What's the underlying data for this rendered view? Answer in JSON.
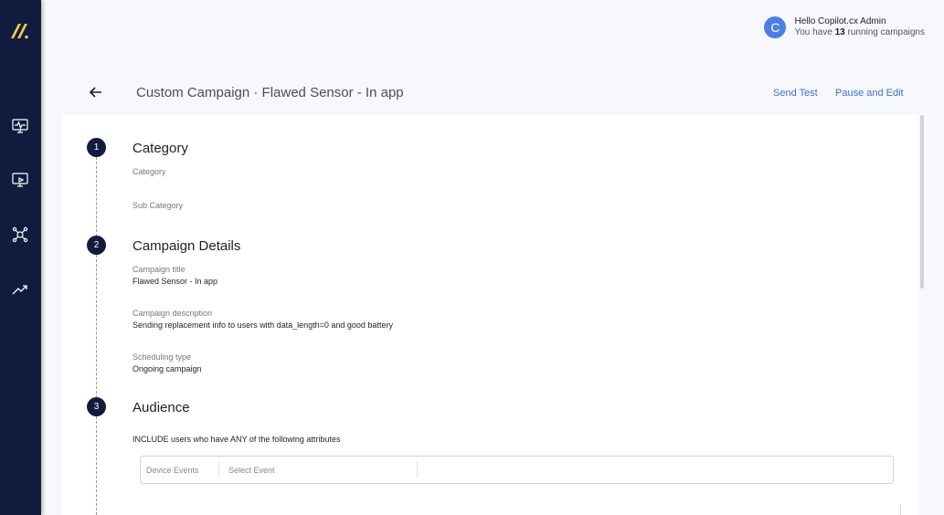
{
  "header": {
    "avatar_letter": "C",
    "greeting": "Hello Copilot.cx Admin",
    "running_prefix": "You have ",
    "running_count": "13",
    "running_suffix": " running campaigns"
  },
  "page": {
    "title": "Custom Campaign · Flawed Sensor - In app",
    "send_test": "Send Test",
    "pause_edit": "Pause and Edit"
  },
  "sidebar": {
    "items": [
      {
        "icon": "monitor-pulse-icon"
      },
      {
        "icon": "presentation-icon"
      },
      {
        "icon": "network-user-icon"
      },
      {
        "icon": "trending-up-icon"
      }
    ]
  },
  "steps": {
    "category": {
      "number": "1",
      "title": "Category",
      "category_label": "Category",
      "subcategory_label": "Sub Category"
    },
    "details": {
      "number": "2",
      "title": "Campaign Details",
      "title_label": "Campaign title",
      "title_value": "Flawed Sensor - In app",
      "description_label": "Campaign description",
      "description_value": "Sending replacement info to users with data_length=0 and good battery",
      "scheduling_label": "Scheduling type",
      "scheduling_value": "Ongoing campaign"
    },
    "audience": {
      "number": "3",
      "title": "Audience",
      "include_text": "INCLUDE users who have ANY of the following attributes",
      "event_type": "Device Events",
      "event_select": "Select Event"
    }
  },
  "colors": {
    "sidebar_bg": "#111b3d",
    "logo_yellow": "#f2c94c",
    "accent_blue": "#3b6fd8",
    "avatar_blue": "#4a7fe6"
  }
}
